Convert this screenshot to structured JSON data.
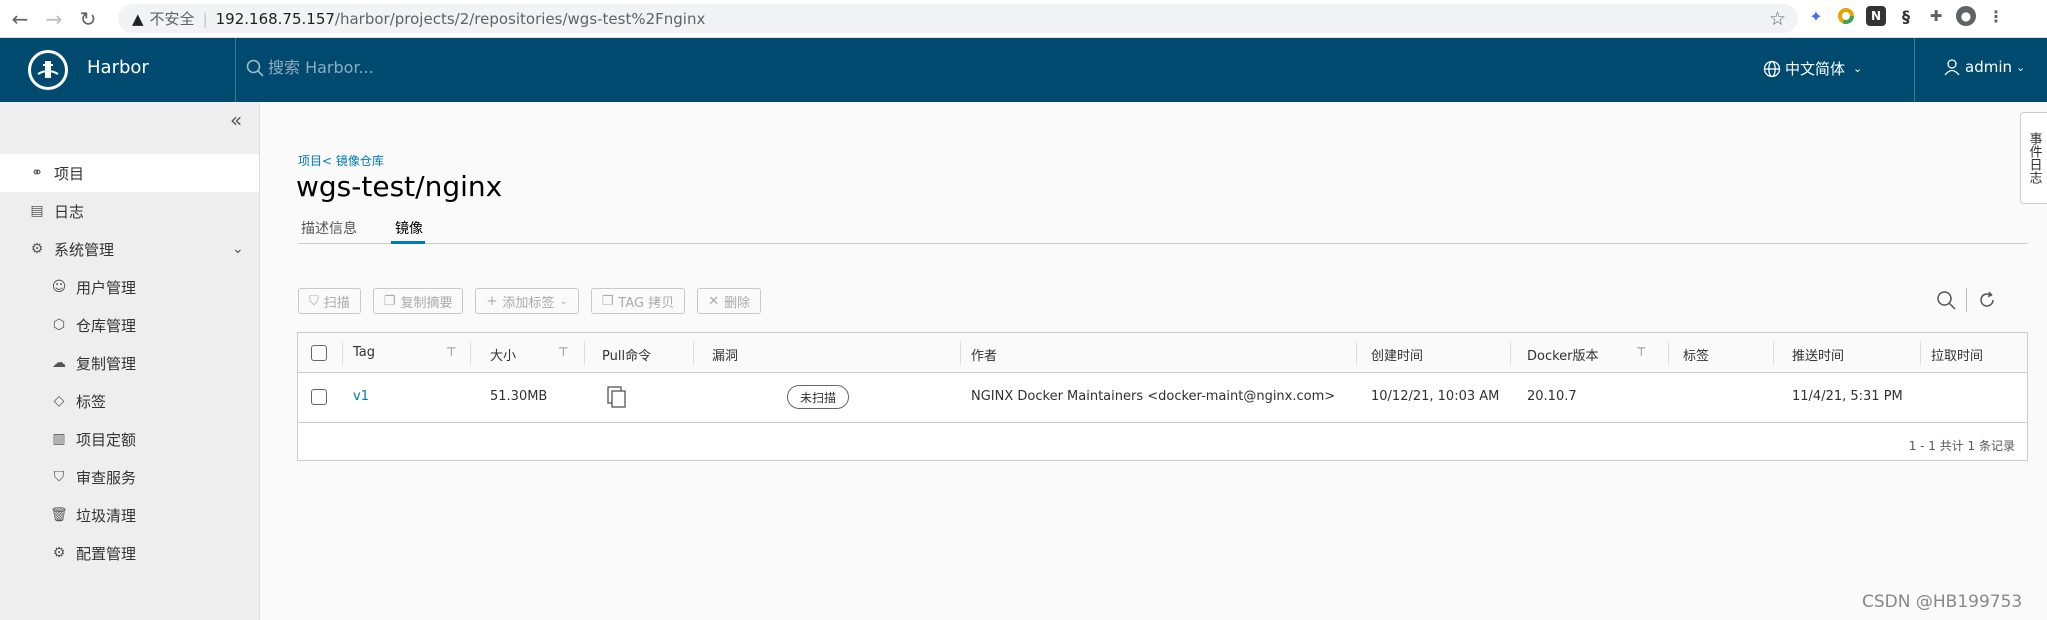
{
  "browser": {
    "insecure_label": "不安全",
    "url_host": "192.168.75.157",
    "url_path": "/harbor/projects/2/repositories/wgs-test%2Fnginx"
  },
  "header": {
    "brand": "Harbor",
    "search_placeholder": "搜索 Harbor...",
    "language": "中文简体",
    "user": "admin"
  },
  "sidebar": {
    "items": [
      {
        "label": "项目",
        "icon": "projects-icon",
        "active": true
      },
      {
        "label": "日志",
        "icon": "logs-icon"
      },
      {
        "label": "系统管理",
        "icon": "admin-icon"
      }
    ],
    "sub_items": [
      {
        "label": "用户管理",
        "icon": "users-icon"
      },
      {
        "label": "仓库管理",
        "icon": "registry-icon"
      },
      {
        "label": "复制管理",
        "icon": "replication-icon"
      },
      {
        "label": "标签",
        "icon": "tag-icon"
      },
      {
        "label": "项目定额",
        "icon": "quota-icon"
      },
      {
        "label": "审查服务",
        "icon": "shield-icon"
      },
      {
        "label": "垃圾清理",
        "icon": "trash-icon"
      },
      {
        "label": "配置管理",
        "icon": "gear-icon"
      }
    ]
  },
  "main": {
    "breadcrumb": "项目< 镜像仓库",
    "title": "wgs-test/nginx",
    "tabs": [
      {
        "label": "描述信息"
      },
      {
        "label": "镜像",
        "active": true
      }
    ],
    "toolbar": {
      "scan": "扫描",
      "copy_digest": "复制摘要",
      "add_label": "添加标签",
      "tag_copy": "TAG 拷贝",
      "delete": "删除"
    }
  },
  "table": {
    "columns": [
      "Tag",
      "大小",
      "Pull命令",
      "漏洞",
      "作者",
      "创建时间",
      "Docker版本",
      "标签",
      "推送时间",
      "拉取时间"
    ],
    "rows": [
      {
        "tag": "v1",
        "size": "51.30MB",
        "vulnerability": "未扫描",
        "author": "NGINX Docker Maintainers <docker-maint@nginx.com>",
        "created": "10/12/21, 10:03 AM",
        "docker_version": "20.10.7",
        "labels": "",
        "push_time": "11/4/21, 5:31 PM",
        "pull_time": ""
      }
    ],
    "footer": "1 - 1 共计 1 条记录"
  },
  "side_tab": "事件日志",
  "watermark": "CSDN @HB199753"
}
